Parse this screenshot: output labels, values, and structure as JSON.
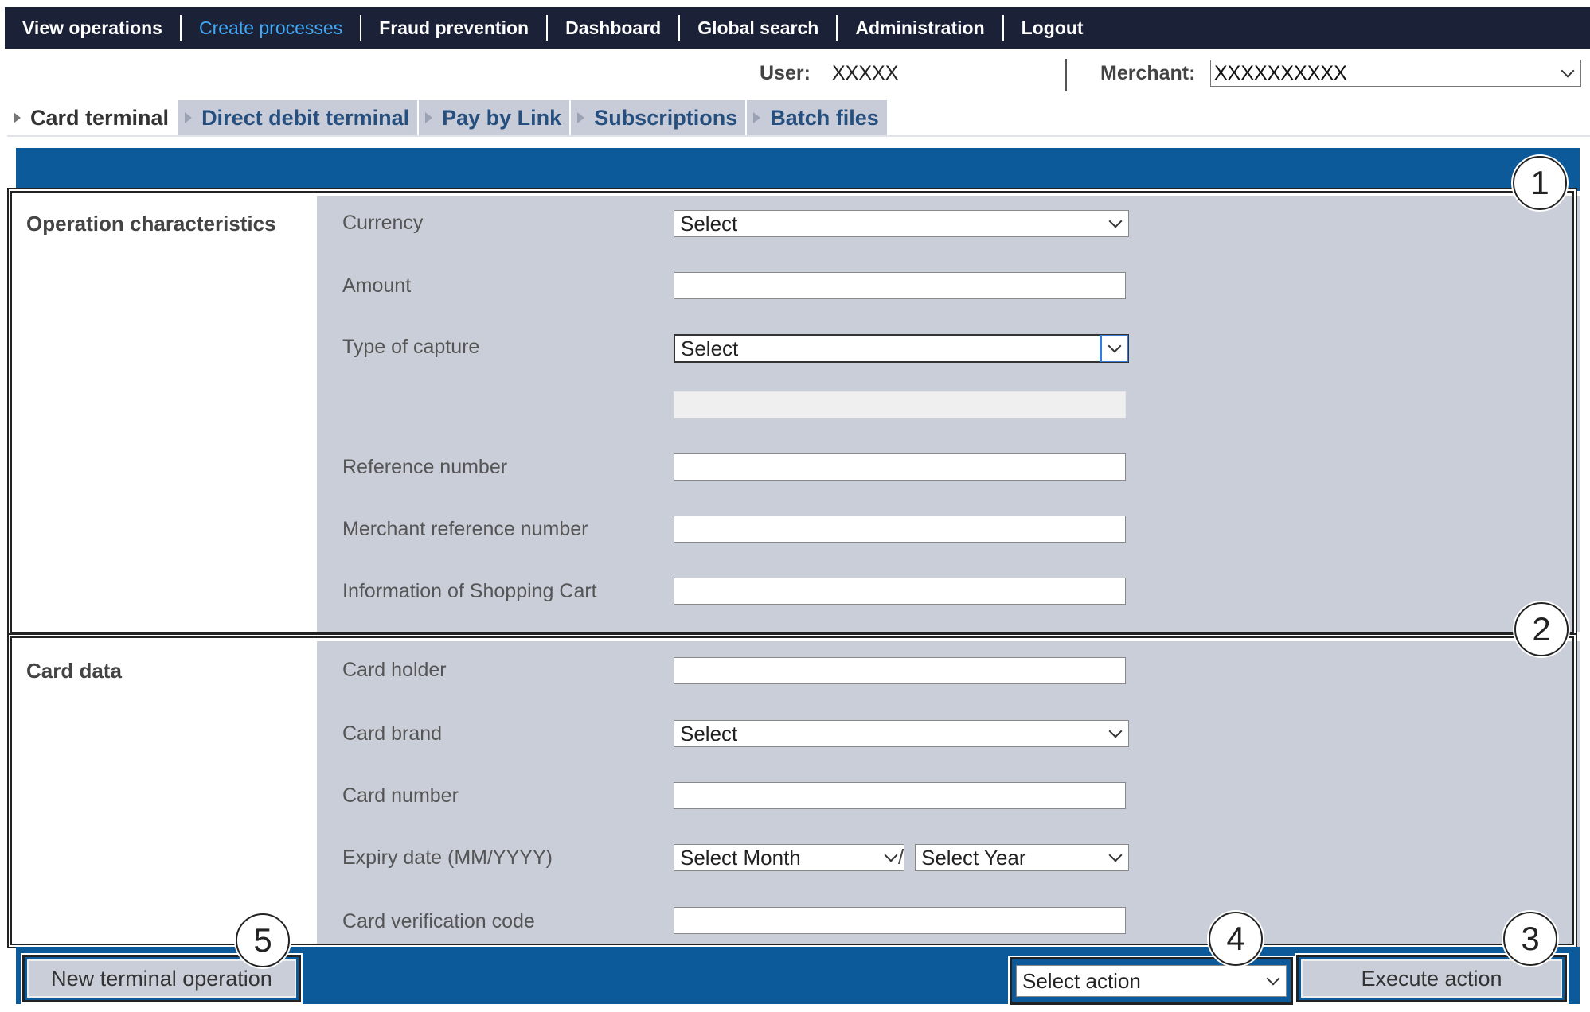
{
  "nav": {
    "items": [
      {
        "label": "View operations",
        "active": false
      },
      {
        "label": "Create processes",
        "active": true
      },
      {
        "label": "Fraud prevention",
        "active": false
      },
      {
        "label": "Dashboard",
        "active": false
      },
      {
        "label": "Global search",
        "active": false
      },
      {
        "label": "Administration",
        "active": false
      },
      {
        "label": "Logout",
        "active": false
      }
    ]
  },
  "userbar": {
    "user_label": "User:",
    "user_value": "XXXXX",
    "merchant_label": "Merchant:",
    "merchant_value": "XXXXXXXXXX"
  },
  "tabs": [
    {
      "label": "Card terminal",
      "active": true
    },
    {
      "label": "Direct debit terminal",
      "active": false
    },
    {
      "label": "Pay by Link",
      "active": false
    },
    {
      "label": "Subscriptions",
      "active": false
    },
    {
      "label": "Batch files",
      "active": false
    }
  ],
  "operation": {
    "title": "Operation characteristics",
    "currency_label": "Currency",
    "currency_value": "Select",
    "amount_label": "Amount",
    "amount_value": "",
    "capture_label": "Type of capture",
    "capture_value": "Select",
    "reference_label": "Reference number",
    "reference_value": "",
    "merchant_ref_label": "Merchant reference number",
    "merchant_ref_value": "",
    "cart_label": "Information of Shopping Cart",
    "cart_value": ""
  },
  "card": {
    "title": "Card data",
    "holder_label": "Card holder",
    "holder_value": "",
    "brand_label": "Card brand",
    "brand_value": "Select",
    "number_label": "Card number",
    "number_value": "",
    "expiry_label": "Expiry date (MM/YYYY)",
    "month_value": "Select Month",
    "separator": "/",
    "year_value": "Select Year",
    "cvc_label": "Card verification code",
    "cvc_value": ""
  },
  "actions": {
    "new_operation": "New terminal operation",
    "select_action": "Select action",
    "execute": "Execute action"
  },
  "callouts": [
    "1",
    "2",
    "3",
    "4",
    "5"
  ],
  "colors": {
    "nav_bg": "#1b2238",
    "nav_active": "#3fa9f5",
    "panel_blue": "#0d5a9b",
    "form_bg": "#c9ced9",
    "tab_text": "#254f7f"
  }
}
